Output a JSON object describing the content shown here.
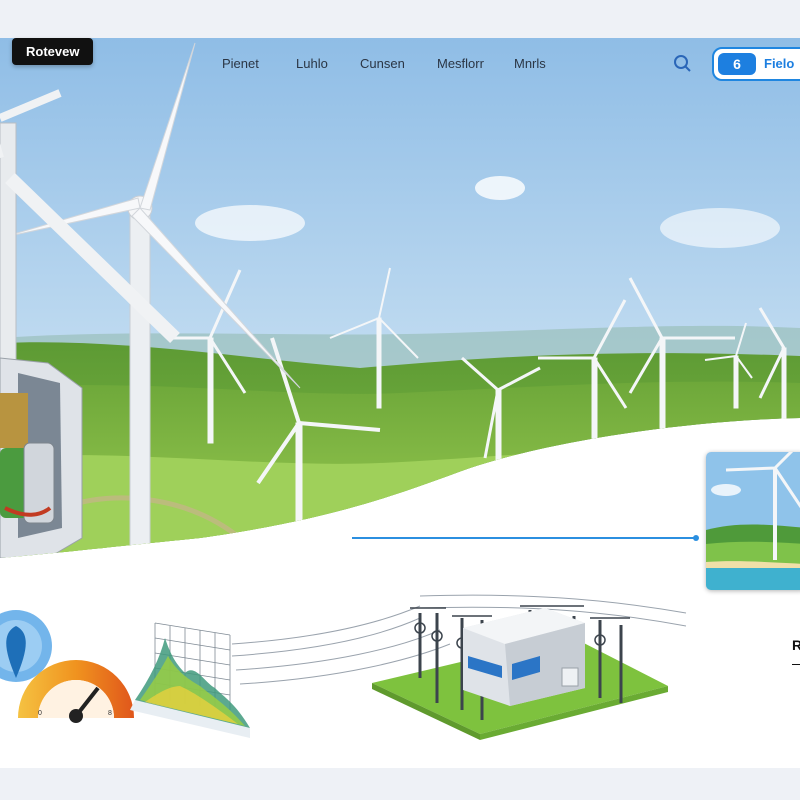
{
  "brand": {
    "label": "Rotevew"
  },
  "nav": {
    "items": [
      "Pienet",
      "Luhlo",
      "Cunsen",
      "Mesflorr",
      "Mnrls"
    ]
  },
  "header": {
    "cta_label": "Fielo",
    "cta_icon_text": "6"
  },
  "side_panel": {
    "heading": "R"
  },
  "colors": {
    "accent": "#1d7fe0",
    "sky": "#a9ceea",
    "grass": "#7cb93f",
    "gauge": "#f08a1c"
  },
  "icons": [
    "search-icon",
    "wind-turbine-icon",
    "gauge-icon",
    "chart-icon",
    "substation-icon"
  ]
}
